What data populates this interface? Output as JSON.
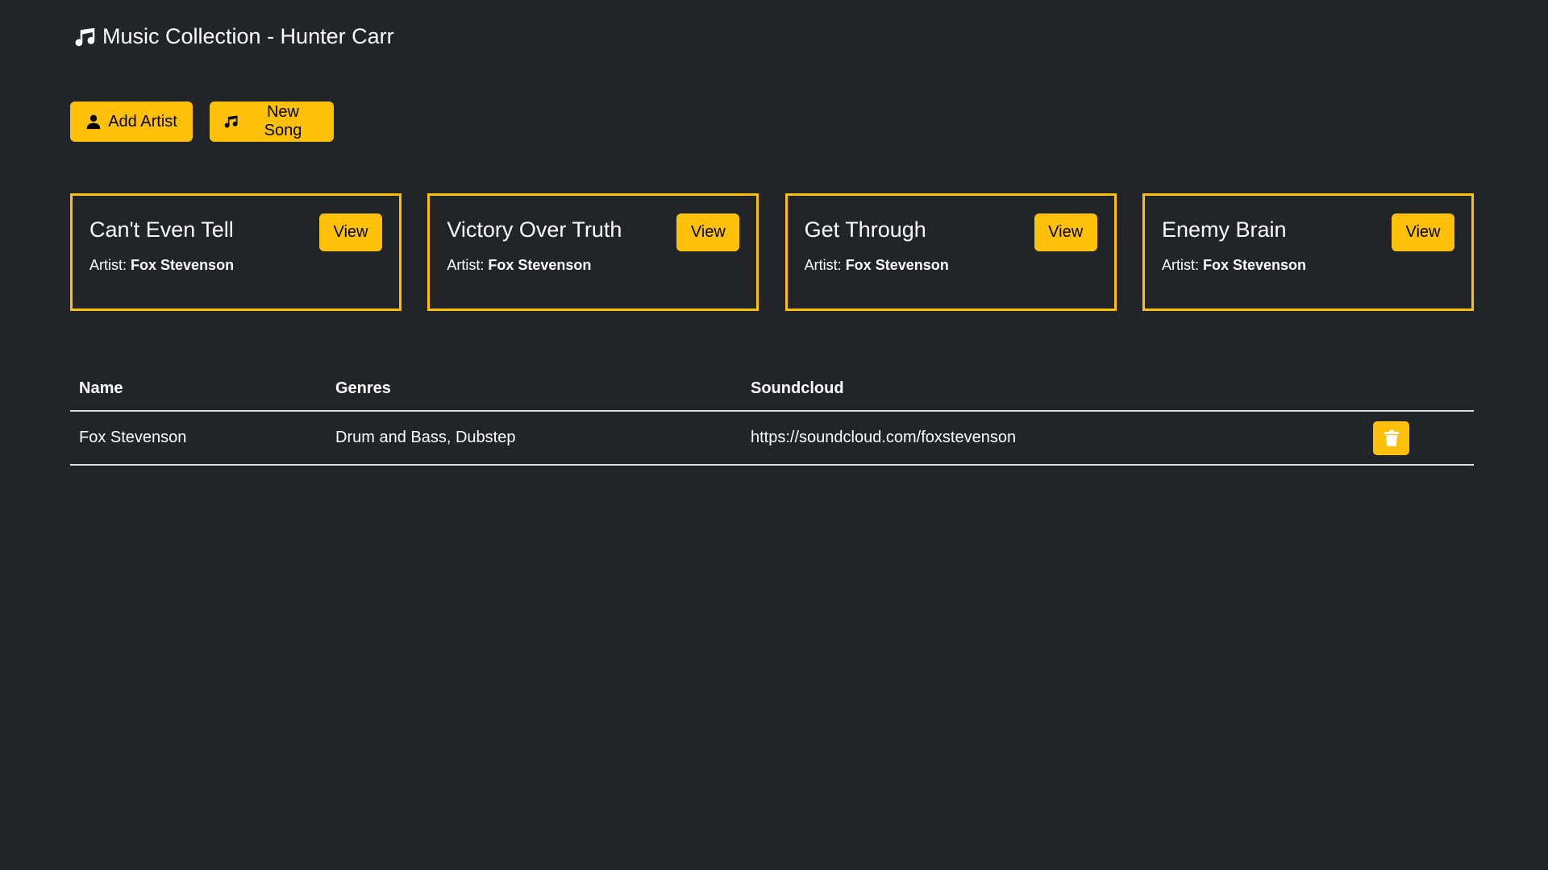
{
  "header": {
    "title": "Music Collection - Hunter Carr",
    "icon": "music-note-icon"
  },
  "actions": {
    "add_artist_label": "Add Artist",
    "add_artist_icon": "person-icon",
    "new_song_label": "New Song",
    "new_song_icon": "music-note-icon"
  },
  "songs": [
    {
      "title": "Can't Even Tell",
      "artist_prefix": "Artist:",
      "artist": "Fox Stevenson",
      "view_label": "View"
    },
    {
      "title": "Victory Over Truth",
      "artist_prefix": "Artist:",
      "artist": "Fox Stevenson",
      "view_label": "View"
    },
    {
      "title": "Get Through",
      "artist_prefix": "Artist:",
      "artist": "Fox Stevenson",
      "view_label": "View"
    },
    {
      "title": "Enemy Brain",
      "artist_prefix": "Artist:",
      "artist": "Fox Stevenson",
      "view_label": "View"
    }
  ],
  "artists_table": {
    "columns": [
      "Name",
      "Genres",
      "Soundcloud"
    ],
    "rows": [
      {
        "name": "Fox Stevenson",
        "genres": "Drum and Bass, Dubstep",
        "soundcloud": "https://soundcloud.com/foxstevenson",
        "action_icon": "trash-icon"
      }
    ]
  },
  "colors": {
    "background": "#212529",
    "accent": "#ffc107",
    "text": "#ffffff",
    "divider": "#dee2e6"
  }
}
